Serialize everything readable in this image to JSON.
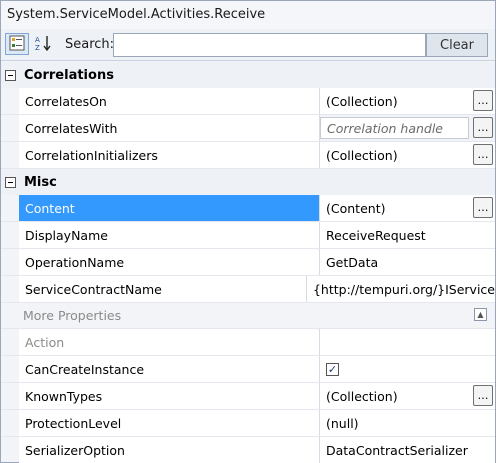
{
  "window": {
    "title": "System.ServiceModel.Activities.Receive"
  },
  "toolbar": {
    "categorized_icon": "categorized-icon",
    "alphabetical_icon": "sort-az-icon",
    "search_label": "Search:",
    "search_value": "",
    "clear_label": "Clear"
  },
  "categories": {
    "correlations": {
      "label": "Correlations",
      "properties": [
        {
          "name": "CorrelatesOn",
          "value": "(Collection)"
        },
        {
          "name": "CorrelatesWith",
          "value": "Correlation handle"
        },
        {
          "name": "CorrelationInitializers",
          "value": "(Collection)"
        }
      ]
    },
    "misc": {
      "label": "Misc",
      "properties": [
        {
          "name": "Content",
          "value": "(Content)"
        },
        {
          "name": "DisplayName",
          "value": "ReceiveRequest"
        },
        {
          "name": "OperationName",
          "value": "GetData"
        },
        {
          "name": "ServiceContractName",
          "value": "{http://tempuri.org/}IService"
        }
      ],
      "more_properties_label": "More Properties",
      "more": [
        {
          "name": "Action",
          "value": ""
        },
        {
          "name": "CanCreateInstance",
          "value": true
        },
        {
          "name": "KnownTypes",
          "value": "(Collection)"
        },
        {
          "name": "ProtectionLevel",
          "value": "(null)"
        },
        {
          "name": "SerializerOption",
          "value": "DataContractSerializer"
        }
      ]
    }
  },
  "colors": {
    "selection": "#3399ff",
    "category_bg": "#eef1f6"
  }
}
